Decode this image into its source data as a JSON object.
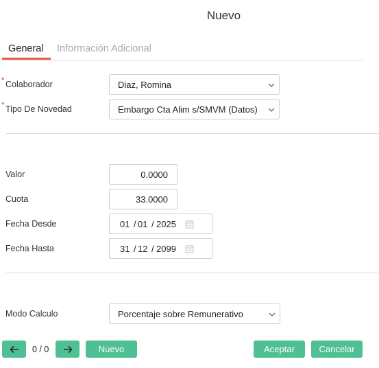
{
  "dialog": {
    "title": "Nuevo"
  },
  "tabs": {
    "general": "General",
    "info": "Información Adicional"
  },
  "form": {
    "colaborador": {
      "label": "Colaborador",
      "value": "Diaz, Romina",
      "required_mark": "*"
    },
    "tipo_novedad": {
      "label": "Tipo De Novedad",
      "value": "Embargo Cta Alim s/SMVM (Datos)",
      "required_mark": "*"
    },
    "valor": {
      "label": "Valor",
      "value": "0.0000"
    },
    "cuota": {
      "label": "Cuota",
      "value": "33.0000"
    },
    "fecha_desde": {
      "label": "Fecha Desde",
      "day": "01",
      "month": "01",
      "year": "2025"
    },
    "fecha_hasta": {
      "label": "Fecha Hasta",
      "day": "31",
      "month": "12",
      "year": "2099"
    },
    "modo_calculo": {
      "label": "Modo Calculo",
      "value": "Porcentaje sobre Remunerativo"
    },
    "date_sep": "/"
  },
  "footer": {
    "pager": "0 / 0",
    "nuevo": "Nuevo",
    "aceptar": "Aceptar",
    "cancelar": "Cancelar"
  },
  "icons": {
    "prev": "arrow-left-icon",
    "next": "arrow-right-icon",
    "dropdown": "chevron-down-icon",
    "calendar": "calendar-icon"
  },
  "colors": {
    "accent": "#4fbf94",
    "tab_active": "#e05a3c",
    "required": "#d0312d"
  }
}
